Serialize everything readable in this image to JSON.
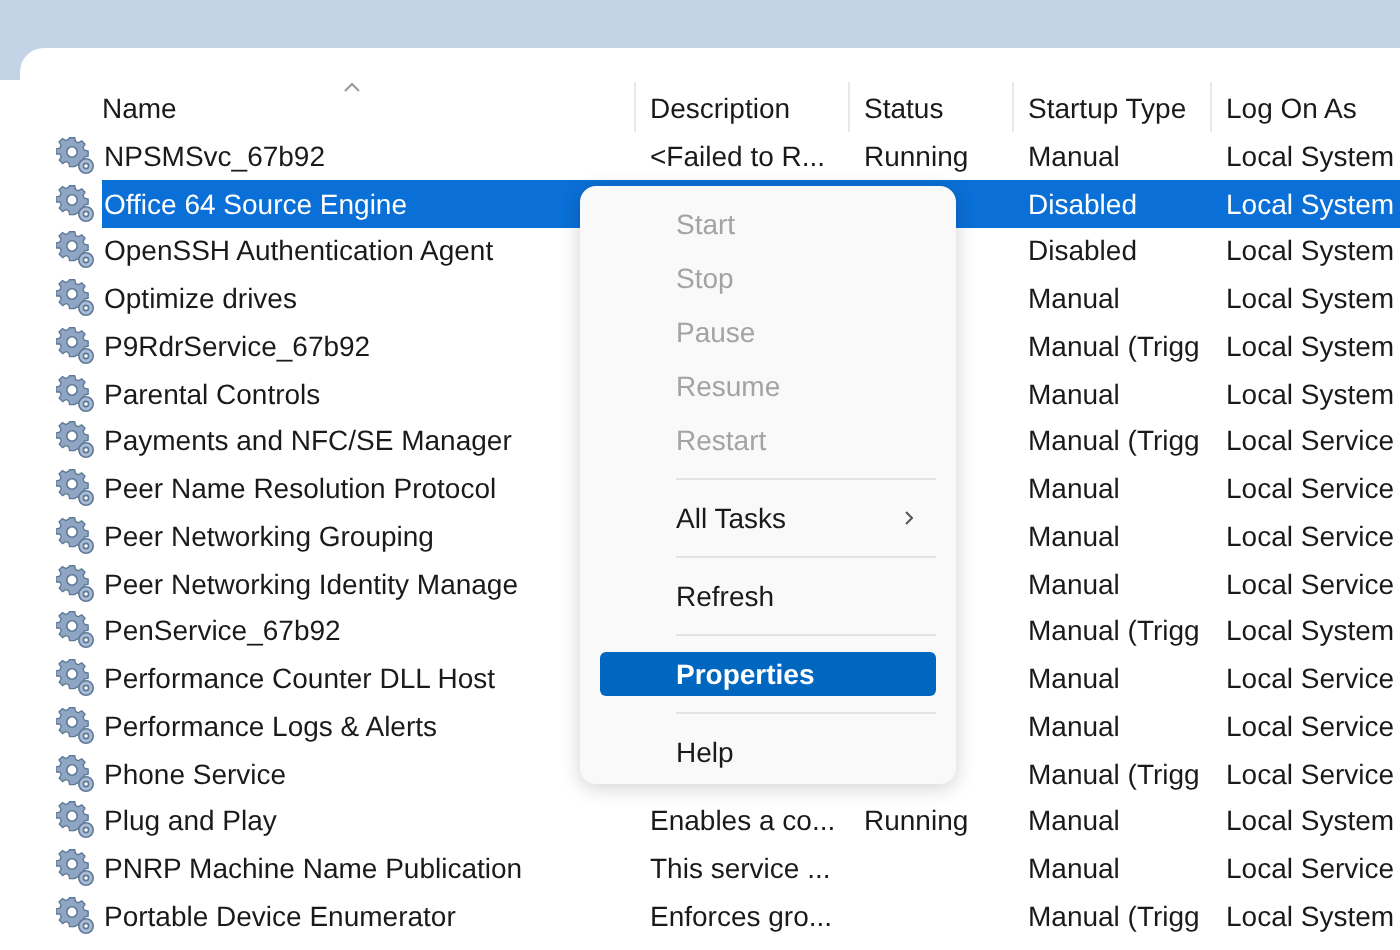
{
  "table": {
    "columns": [
      {
        "label": "Name",
        "sorted": true
      },
      {
        "label": "Description",
        "sorted": false
      },
      {
        "label": "Status",
        "sorted": false
      },
      {
        "label": "Startup Type",
        "sorted": false
      },
      {
        "label": "Log On As",
        "sorted": false
      }
    ],
    "rows": [
      {
        "name": "NPSMSvc_67b92",
        "description": "<Failed to R...",
        "status": "Running",
        "startup": "Manual",
        "logon": "Local System",
        "selected": false
      },
      {
        "name": "Office 64 Source Engine",
        "startup": "Disabled",
        "logon": "Local System",
        "selected": true
      },
      {
        "name": "OpenSSH Authentication Agent",
        "startup": "Disabled",
        "logon": "Local System",
        "selected": false
      },
      {
        "name": "Optimize drives",
        "startup": "Manual",
        "logon": "Local System",
        "selected": false
      },
      {
        "name": "P9RdrService_67b92",
        "startup": "Manual (Trigg",
        "logon": "Local System",
        "selected": false
      },
      {
        "name": "Parental Controls",
        "startup": "Manual",
        "logon": "Local System",
        "selected": false
      },
      {
        "name": "Payments and NFC/SE Manager",
        "startup": "Manual (Trigg",
        "logon": "Local Service",
        "selected": false
      },
      {
        "name": "Peer Name Resolution Protocol",
        "startup": "Manual",
        "logon": "Local Service",
        "selected": false
      },
      {
        "name": "Peer Networking Grouping",
        "startup": "Manual",
        "logon": "Local Service",
        "selected": false
      },
      {
        "name": "Peer Networking Identity Manage",
        "startup": "Manual",
        "logon": "Local Service",
        "selected": false
      },
      {
        "name": "PenService_67b92",
        "startup": "Manual (Trigg",
        "logon": "Local System",
        "selected": false
      },
      {
        "name": "Performance Counter DLL Host",
        "startup": "Manual",
        "logon": "Local Service",
        "selected": false
      },
      {
        "name": "Performance Logs & Alerts",
        "startup": "Manual",
        "logon": "Local Service",
        "selected": false
      },
      {
        "name": "Phone Service",
        "startup": "Manual (Trigg",
        "logon": "Local Service",
        "selected": false
      },
      {
        "name": "Plug and Play",
        "description": "Enables a co...",
        "status": "Running",
        "startup": "Manual",
        "logon": "Local System",
        "selected": false
      },
      {
        "name": "PNRP Machine Name Publication",
        "description": "This service ...",
        "startup": "Manual",
        "logon": "Local Service",
        "selected": false
      },
      {
        "name": "Portable Device Enumerator",
        "description": "Enforces gro...",
        "startup": "Manual (Trigg",
        "logon": "Local System",
        "selected": false
      }
    ]
  },
  "context_menu": {
    "groups": [
      [
        {
          "label": "Start",
          "disabled": true,
          "selected": false,
          "submenu": false
        },
        {
          "label": "Stop",
          "disabled": true,
          "selected": false,
          "submenu": false
        },
        {
          "label": "Pause",
          "disabled": true,
          "selected": false,
          "submenu": false
        },
        {
          "label": "Resume",
          "disabled": true,
          "selected": false,
          "submenu": false
        },
        {
          "label": "Restart",
          "disabled": true,
          "selected": false,
          "submenu": false
        }
      ],
      [
        {
          "label": "All Tasks",
          "disabled": false,
          "selected": false,
          "submenu": true
        }
      ],
      [
        {
          "label": "Refresh",
          "disabled": false,
          "selected": false,
          "submenu": false
        }
      ],
      [
        {
          "label": "Properties",
          "disabled": false,
          "selected": true,
          "submenu": false
        }
      ],
      [
        {
          "label": "Help",
          "disabled": false,
          "selected": false,
          "submenu": false
        }
      ]
    ]
  }
}
